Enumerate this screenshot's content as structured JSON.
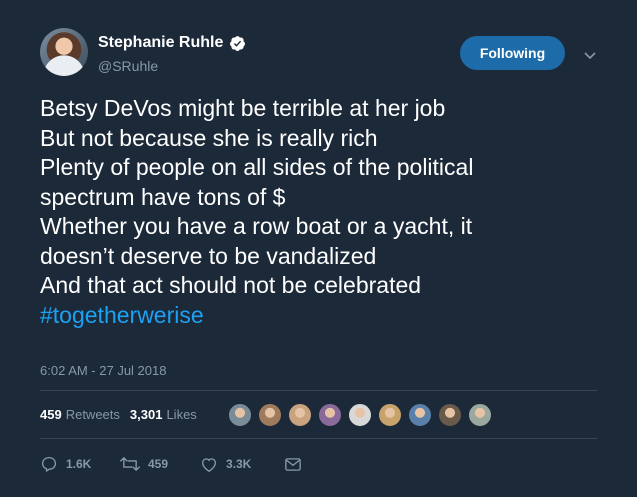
{
  "author": {
    "display_name": "Stephanie Ruhle",
    "handle": "@SRuhle",
    "verified_icon": "verified-badge-icon"
  },
  "follow_button": {
    "label": "Following",
    "color": "#1d6ba8"
  },
  "menu": {
    "icon": "chevron-down-icon"
  },
  "tweet": {
    "lines": [
      "Betsy DeVos might be terrible at her job",
      "But not because she is really rich",
      "Plenty of people on all sides of the political",
      "spectrum have tons of $",
      "Whether you have a row boat or a yacht, it",
      "doesn’t deserve to be vandalized",
      "And that act should not be celebrated"
    ],
    "hashtag": "#togetherwerise",
    "hashtag_color": "#1da1f2"
  },
  "timestamp": "6:02 AM - 27 Jul 2018",
  "stats": {
    "retweets_count": "459",
    "retweets_label": "Retweets",
    "likes_count": "3,301",
    "likes_label": "Likes"
  },
  "likers": {
    "icon": "liker-avatar-icon",
    "colors": [
      "#7b8c99",
      "#a07a5c",
      "#c9a27f",
      "#8a6a9a",
      "#d8d8d8",
      "#c7a26a",
      "#5a7fa8",
      "#6a5a4a",
      "#9aa8a0"
    ]
  },
  "actions": {
    "reply": {
      "icon": "reply-icon",
      "count": "1.6K"
    },
    "retweet": {
      "icon": "retweet-icon",
      "count": "459"
    },
    "like": {
      "icon": "heart-icon",
      "count": "3.3K"
    },
    "message": {
      "icon": "envelope-icon"
    }
  },
  "colors": {
    "background": "#1c2938",
    "secondary_text": "#8899a6",
    "divider": "#38444d"
  }
}
